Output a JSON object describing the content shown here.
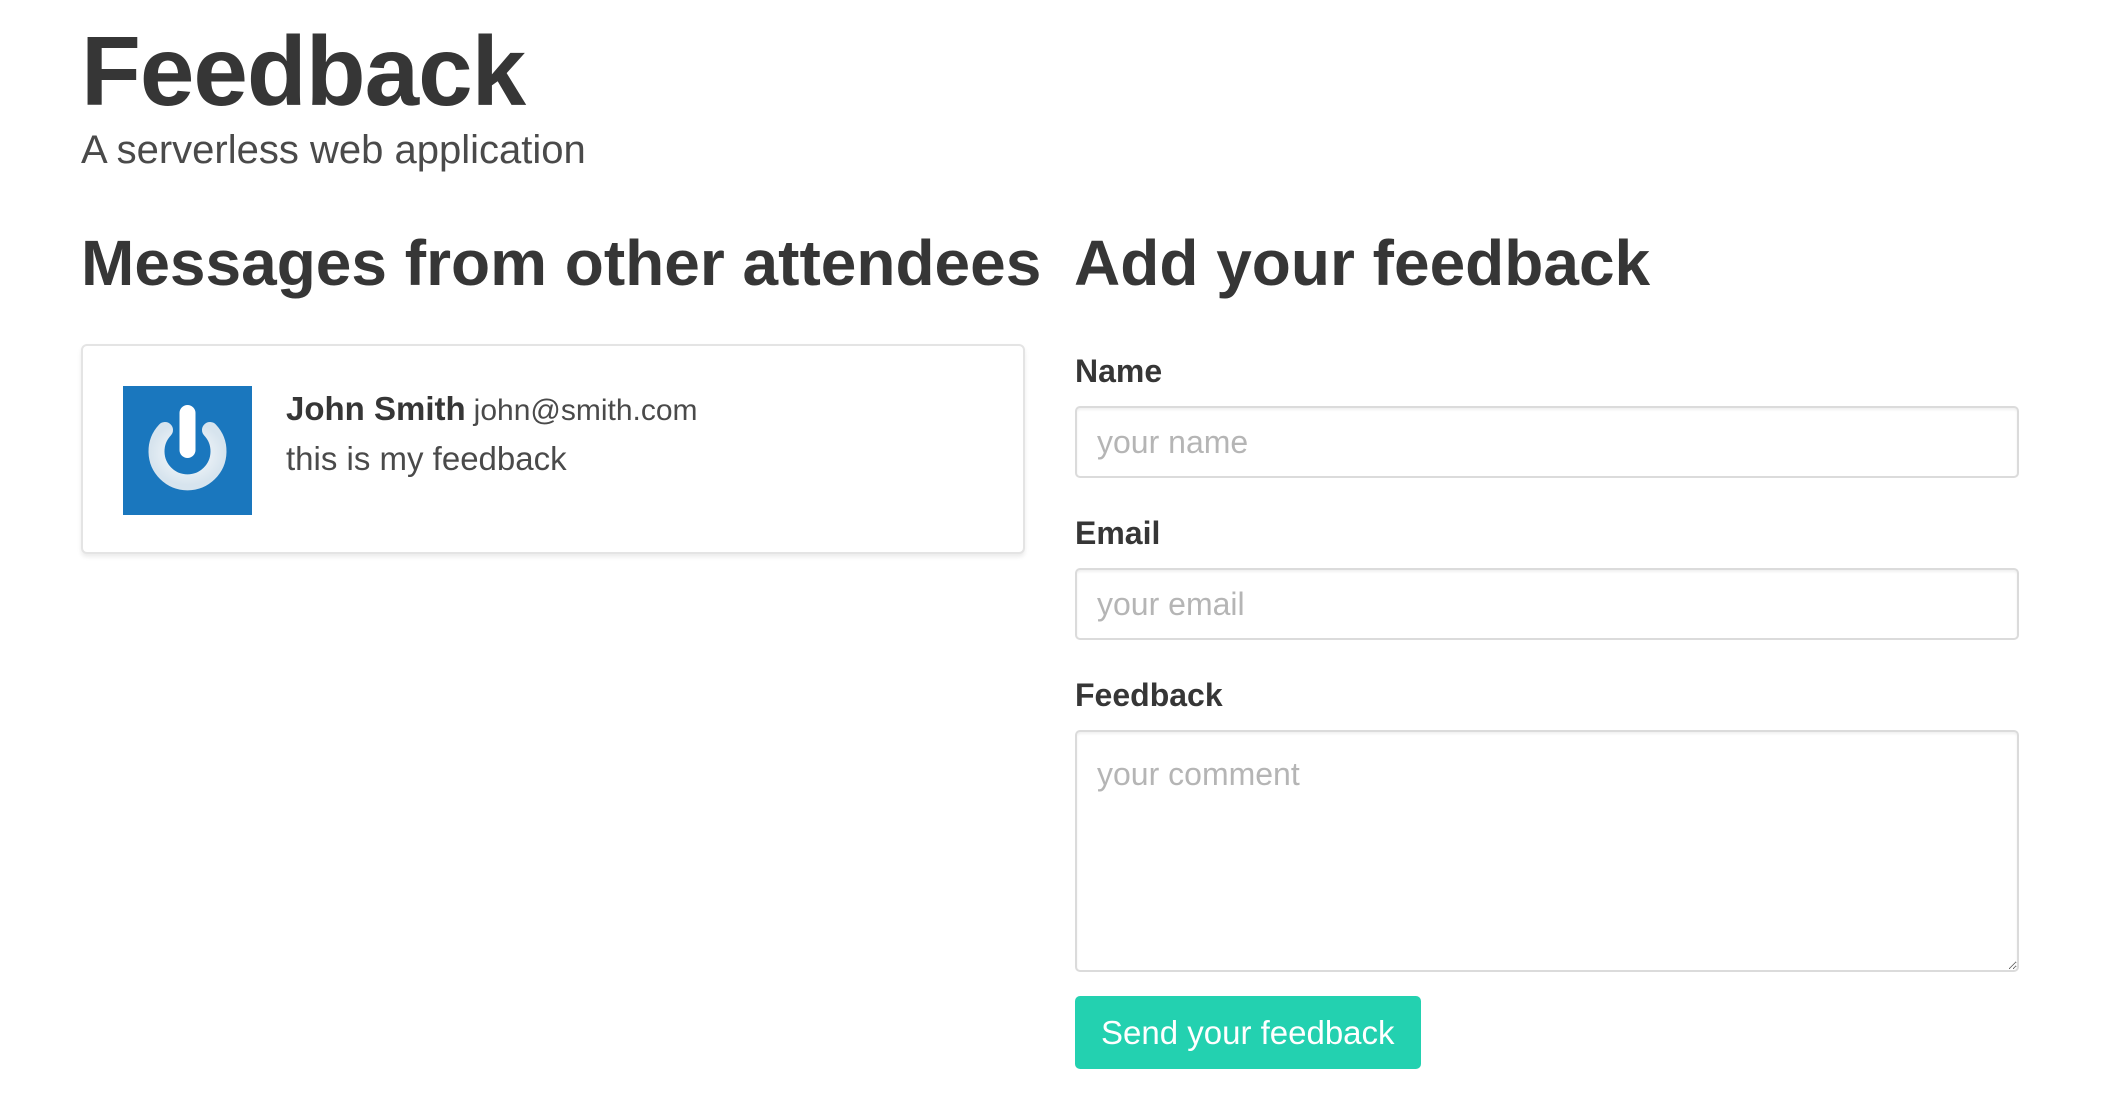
{
  "hero": {
    "title": "Feedback",
    "subtitle": "A serverless web application"
  },
  "messages": {
    "title": "Messages from other attendees",
    "items": [
      {
        "avatar_icon": "power-icon",
        "avatar_color": "#1a77be",
        "name": "John Smith",
        "email": "john@smith.com",
        "text": "this is my feedback"
      }
    ]
  },
  "form": {
    "title": "Add your feedback",
    "name_label": "Name",
    "name_placeholder": "your name",
    "email_label": "Email",
    "email_placeholder": "your email",
    "feedback_label": "Feedback",
    "feedback_placeholder": "your comment",
    "submit_label": "Send your feedback",
    "submit_color": "#23d1b0"
  }
}
